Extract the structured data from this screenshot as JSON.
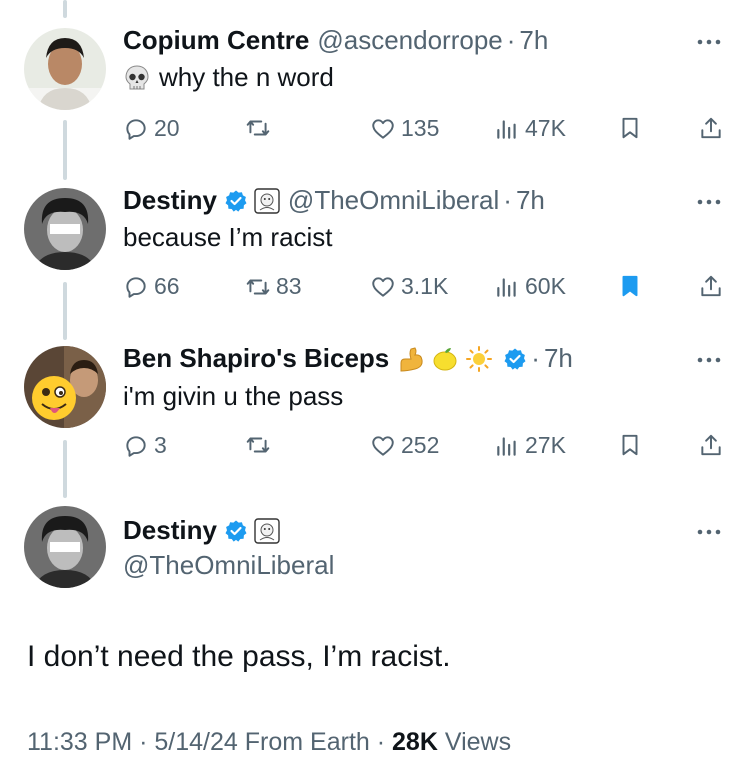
{
  "tweets": [
    {
      "name": "Copium Centre",
      "handle": "@ascendorrope",
      "time": "7h",
      "text": "why the n word",
      "text_emoji": "skull-emoji",
      "replies": "20",
      "reposts": "",
      "likes": "135",
      "views": "47K",
      "bookmarked": false
    },
    {
      "name": "Destiny",
      "handle": "@TheOmniLiberal",
      "time": "7h",
      "text": "because I’m racist",
      "verified": true,
      "replies": "66",
      "reposts": "83",
      "likes": "3.1K",
      "views": "60K",
      "bookmarked": true
    },
    {
      "name": "Ben Shapiro's Biceps",
      "emojis": [
        "flexed-biceps-emoji",
        "lemon-emoji",
        "sun-emoji"
      ],
      "time": "7h",
      "text": "i'm givin u the pass",
      "verified": true,
      "replies": "3",
      "reposts": "",
      "likes": "252",
      "views": "27K",
      "bookmarked": false
    }
  ],
  "main_tweet": {
    "name": "Destiny",
    "handle": "@TheOmniLiberal",
    "text": "I don’t need the pass, I’m racist.",
    "time": "11:33 PM",
    "date": "5/14/24",
    "source": "From Earth",
    "views": "28K",
    "views_label": "Views"
  },
  "separator": "·",
  "colors": {
    "text": "#0f1419",
    "secondary": "#536471",
    "verified": "#1d9bf0",
    "bookmark_active": "#1d9bf0",
    "thread_line": "#cfd9de"
  }
}
